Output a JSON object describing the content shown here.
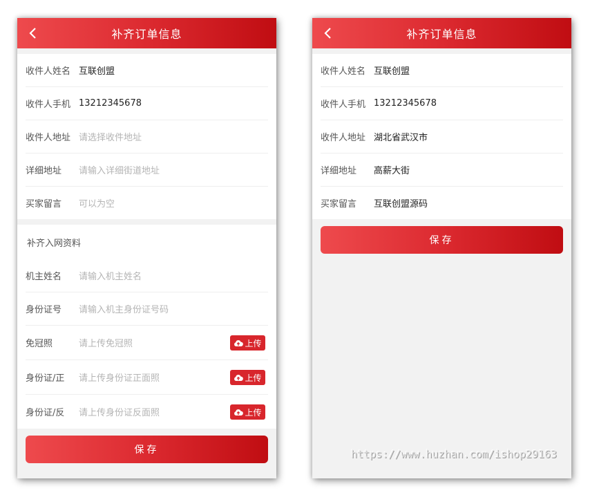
{
  "screen1": {
    "header": {
      "title": "补齐订单信息"
    },
    "order_fields": [
      {
        "label": "收件人姓名",
        "value": "互联创盟",
        "placeholder": ""
      },
      {
        "label": "收件人手机",
        "value": "13212345678",
        "placeholder": ""
      },
      {
        "label": "收件人地址",
        "value": "",
        "placeholder": "请选择收件地址"
      },
      {
        "label": "详细地址",
        "value": "",
        "placeholder": "请输入详细街道地址"
      },
      {
        "label": "买家留言",
        "value": "",
        "placeholder": "可以为空"
      }
    ],
    "network_section": {
      "title": "补齐入网资料",
      "fields": [
        {
          "label": "机主姓名",
          "placeholder": "请输入机主姓名"
        },
        {
          "label": "身份证号",
          "placeholder": "请输入机主身份证号码"
        }
      ],
      "uploads": [
        {
          "label": "免冠照",
          "placeholder": "请上传免冠照",
          "button": "上传"
        },
        {
          "label": "身份证/正",
          "placeholder": "请上传身份证正面照",
          "button": "上传"
        },
        {
          "label": "身份证/反",
          "placeholder": "请上传身份证反面照",
          "button": "上传"
        }
      ]
    },
    "save_label": "保存"
  },
  "screen2": {
    "header": {
      "title": "补齐订单信息"
    },
    "order_fields": [
      {
        "label": "收件人姓名",
        "value": "互联创盟"
      },
      {
        "label": "收件人手机",
        "value": "13212345678"
      },
      {
        "label": "收件人地址",
        "value": "湖北省武汉市"
      },
      {
        "label": "详细地址",
        "value": "高薪大街"
      },
      {
        "label": "买家留言",
        "value": "互联创盟源码"
      }
    ],
    "save_label": "保存"
  },
  "watermark": "https://www.huzhan.com/ishop29163",
  "colors": {
    "accent": "#d8262c",
    "accent_dark": "#c00d12",
    "accent_light": "#ee4a4d"
  },
  "icons": {
    "back": "chevron-left-icon",
    "upload": "cloud-upload-icon"
  }
}
